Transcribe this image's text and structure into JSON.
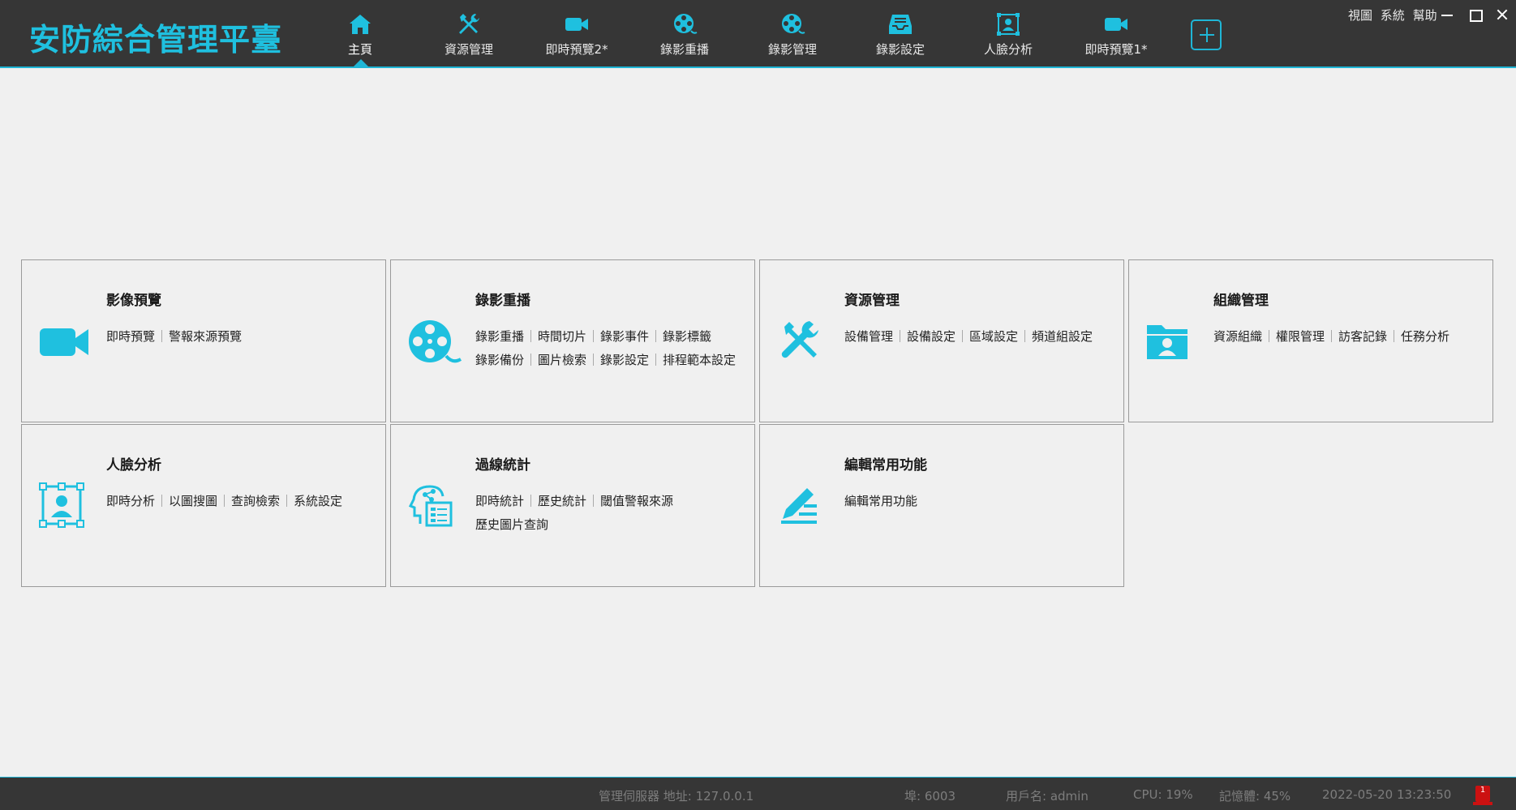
{
  "app": {
    "title": "安防綜合管理平臺"
  },
  "colors": {
    "accent": "#1fc0df",
    "bar": "#363636",
    "page": "#f0f0f0"
  },
  "nav": {
    "tabs": [
      {
        "label": "主頁",
        "icon": "home-icon",
        "active": true
      },
      {
        "label": "資源管理",
        "icon": "tools-icon"
      },
      {
        "label": "即時預覽2*",
        "icon": "video-camera-icon"
      },
      {
        "label": "錄影重播",
        "icon": "film-reel-icon"
      },
      {
        "label": "錄影管理",
        "icon": "film-reel-icon"
      },
      {
        "label": "錄影設定",
        "icon": "storage-tray-icon"
      },
      {
        "label": "人臉分析",
        "icon": "face-frame-icon"
      },
      {
        "label": "即時預覽1*",
        "icon": "video-camera-icon"
      }
    ],
    "add_tab_icon": "plus-icon"
  },
  "menu": {
    "view": "視圖",
    "system": "系統",
    "help": "幫助"
  },
  "cards": [
    {
      "title": "影像預覽",
      "icon": "video-camera-icon",
      "rows": [
        [
          "即時預覽",
          "警報來源預覽"
        ]
      ]
    },
    {
      "title": "錄影重播",
      "icon": "film-reel-icon",
      "rows": [
        [
          "錄影重播",
          "時間切片",
          "錄影事件",
          "錄影標籤"
        ],
        [
          "錄影備份",
          "圖片檢索",
          "錄影設定",
          "排程範本設定"
        ]
      ]
    },
    {
      "title": "資源管理",
      "icon": "tools-icon",
      "rows": [
        [
          "設備管理",
          "設備設定",
          "區域設定",
          "頻道組設定"
        ]
      ]
    },
    {
      "title": "組織管理",
      "icon": "user-folder-icon",
      "rows": [
        [
          "資源組織",
          "權限管理",
          "訪客記錄",
          "任務分析"
        ]
      ]
    },
    {
      "title": "人臉分析",
      "icon": "face-frame-icon",
      "rows": [
        [
          "即時分析",
          "以圖搜圖",
          "查詢檢索",
          "系統設定"
        ]
      ]
    },
    {
      "title": "過線統計",
      "icon": "head-chart-icon",
      "rows": [
        [
          "即時統計",
          "歷史統計",
          "閾值警報來源"
        ],
        [
          "歷史圖片查詢"
        ]
      ]
    },
    {
      "title": "編輯常用功能",
      "icon": "edit-pen-icon",
      "rows": [
        [
          "編輯常用功能"
        ]
      ]
    }
  ],
  "status": {
    "server": "管理伺服器 地址: 127.0.0.1",
    "port": "埠: 6003",
    "user": "用戶名: admin",
    "cpu": "CPU: 19%",
    "memory": "記憶體: 45%",
    "datetime": "2022-05-20 13:23:50",
    "alarm_count": "1"
  }
}
